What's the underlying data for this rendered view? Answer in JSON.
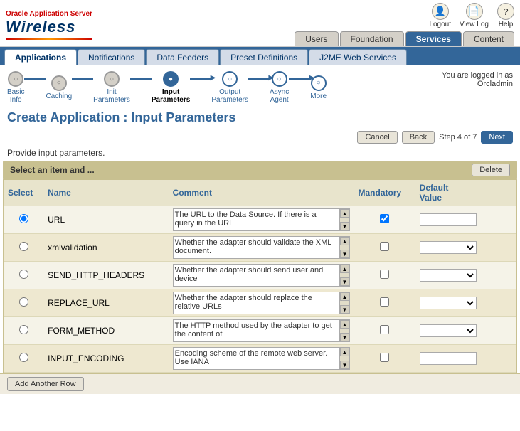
{
  "header": {
    "oracle_text": "Oracle Application Server",
    "wireless_text": "Wireless",
    "icons": [
      {
        "label": "Logout",
        "symbol": "👤"
      },
      {
        "label": "View Log",
        "symbol": "📄"
      },
      {
        "label": "Help",
        "symbol": "?"
      }
    ],
    "main_tabs": [
      {
        "label": "Users",
        "active": false
      },
      {
        "label": "Foundation",
        "active": false
      },
      {
        "label": "Services",
        "active": true
      },
      {
        "label": "Content",
        "active": false
      }
    ]
  },
  "nav": {
    "tabs": [
      {
        "label": "Applications",
        "active": true
      },
      {
        "label": "Notifications",
        "active": false
      },
      {
        "label": "Data Feeders",
        "active": false
      },
      {
        "label": "Preset Definitions",
        "active": false
      },
      {
        "label": "J2ME Web Services",
        "active": false
      }
    ]
  },
  "wizard": {
    "steps": [
      {
        "label": "Basic\nInfo",
        "active": false,
        "done": true
      },
      {
        "label": "Caching",
        "active": false,
        "done": true
      },
      {
        "label": "Init\nParameters",
        "active": false,
        "done": true
      },
      {
        "label": "Input\nParameters",
        "active": true,
        "done": false
      },
      {
        "label": "Output\nParameters",
        "active": false,
        "done": false
      },
      {
        "label": "Async\nAgent",
        "active": false,
        "done": false
      },
      {
        "label": "More",
        "active": false,
        "done": false
      }
    ],
    "logged_in_label": "You are logged in as",
    "logged_in_user": "Orcladmin"
  },
  "page": {
    "title": "Create Application : Input Parameters",
    "provide_text": "Provide input parameters."
  },
  "toolbar": {
    "cancel_label": "Cancel",
    "back_label": "Back",
    "step_label": "Step 4 of 7",
    "next_label": "Next"
  },
  "table": {
    "select_header_text": "Select an item and ...",
    "delete_label": "Delete",
    "columns": {
      "select": "Select",
      "name": "Name",
      "comment": "Comment",
      "mandatory": "Mandatory",
      "default": "Default\nValue"
    },
    "rows": [
      {
        "selected": true,
        "name": "URL",
        "comment": "The URL to the Data Source. If there is a query in the URL",
        "mandatory": true,
        "default_type": "input",
        "default_value": ""
      },
      {
        "selected": false,
        "name": "xmlvalidation",
        "comment": "Whether the adapter should validate the XML document.",
        "mandatory": false,
        "default_type": "select",
        "default_value": ""
      },
      {
        "selected": false,
        "name": "SEND_HTTP_HEADERS",
        "comment": "Whether the adapter should send user and device",
        "mandatory": false,
        "default_type": "select",
        "default_value": ""
      },
      {
        "selected": false,
        "name": "REPLACE_URL",
        "comment": "Whether the adapter should replace the relative URLs",
        "mandatory": false,
        "default_type": "select",
        "default_value": ""
      },
      {
        "selected": false,
        "name": "FORM_METHOD",
        "comment": "The HTTP method used by the adapter to get the content of",
        "mandatory": false,
        "default_type": "select",
        "default_value": ""
      },
      {
        "selected": false,
        "name": "INPUT_ENCODING",
        "comment": "Encoding scheme of the remote web server. Use IANA",
        "mandatory": false,
        "default_type": "input",
        "default_value": ""
      }
    ]
  },
  "footer": {
    "add_row_label": "Add Another Row"
  }
}
